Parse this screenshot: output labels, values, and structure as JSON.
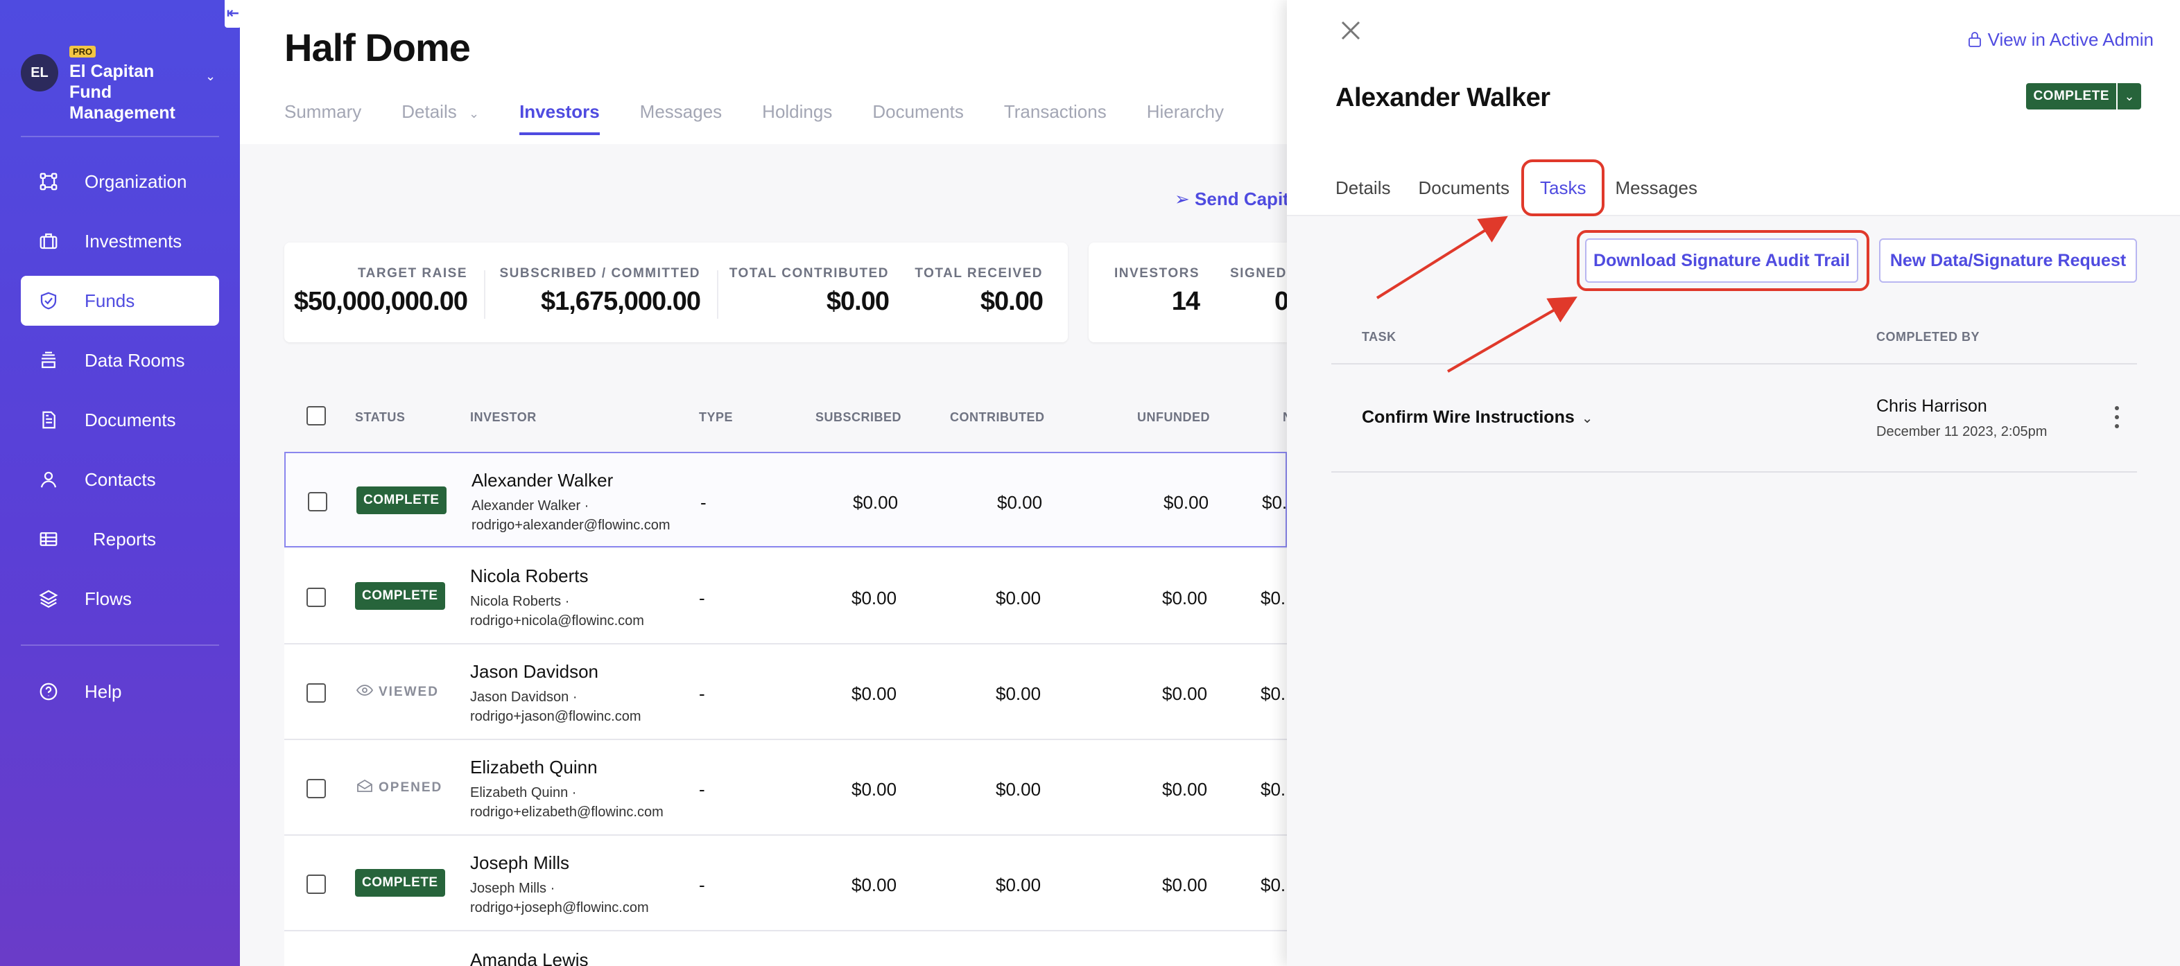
{
  "sidebar": {
    "org_initials": "EL",
    "org_badge": "PRO",
    "org_name": "El Capitan Fund Management",
    "items": [
      {
        "label": "Organization",
        "icon": "organization-icon"
      },
      {
        "label": "Investments",
        "icon": "briefcase-icon"
      },
      {
        "label": "Funds",
        "icon": "shield-check-icon",
        "active": true
      },
      {
        "label": "Data Rooms",
        "icon": "database-icon"
      },
      {
        "label": "Documents",
        "icon": "document-icon"
      },
      {
        "label": "Contacts",
        "icon": "person-icon"
      },
      {
        "label": "Reports",
        "icon": "table-icon"
      },
      {
        "label": "Flows",
        "icon": "layers-icon"
      }
    ],
    "help_label": "Help",
    "collapse_glyph": "⇤"
  },
  "main": {
    "title": "Half Dome",
    "tabs": [
      "Summary",
      "Details",
      "Investors",
      "Messages",
      "Holdings",
      "Documents",
      "Transactions",
      "Hierarchy"
    ],
    "active_tab": "Investors",
    "send_link": "Send Capit",
    "stats_card1": [
      {
        "label": "TARGET RAISE",
        "value": "$50,000,000.00"
      },
      {
        "label": "SUBSCRIBED / COMMITTED",
        "value": "$1,675,000.00"
      },
      {
        "label": "TOTAL CONTRIBUTED",
        "value": "$0.00"
      },
      {
        "label": "TOTAL RECEIVED",
        "value": "$0.00"
      }
    ],
    "stats_card2": [
      {
        "label": "INVESTORS",
        "value": "14"
      },
      {
        "label": "SIGNED",
        "value": "0"
      }
    ],
    "table": {
      "headers": [
        "STATUS",
        "INVESTOR",
        "TYPE",
        "SUBSCRIBED",
        "CONTRIBUTED",
        "UNFUNDED",
        "N"
      ],
      "rows": [
        {
          "status": "COMPLETE",
          "name": "Alexander Walker",
          "sub1": "Alexander Walker ·",
          "email": "rodrigo+alexander@flowinc.com",
          "type": "-",
          "subscribed": "$0.00",
          "contributed": "$0.00",
          "unfunded": "$0.00",
          "next": "$0."
        },
        {
          "status": "COMPLETE",
          "name": "Nicola Roberts",
          "sub1": "Nicola Roberts ·",
          "email": "rodrigo+nicola@flowinc.com",
          "type": "-",
          "subscribed": "$0.00",
          "contributed": "$0.00",
          "unfunded": "$0.00",
          "next": "$0."
        },
        {
          "status": "VIEWED",
          "name": "Jason Davidson",
          "sub1": "Jason Davidson ·",
          "email": "rodrigo+jason@flowinc.com",
          "type": "-",
          "subscribed": "$0.00",
          "contributed": "$0.00",
          "unfunded": "$0.00",
          "next": "$0."
        },
        {
          "status": "OPENED",
          "name": "Elizabeth Quinn",
          "sub1": "Elizabeth Quinn ·",
          "email": "rodrigo+elizabeth@flowinc.com",
          "type": "-",
          "subscribed": "$0.00",
          "contributed": "$0.00",
          "unfunded": "$0.00",
          "next": "$0."
        },
        {
          "status": "COMPLETE",
          "name": "Joseph Mills",
          "sub1": "Joseph Mills ·",
          "email": "rodrigo+joseph@flowinc.com",
          "type": "-",
          "subscribed": "$0.00",
          "contributed": "$0.00",
          "unfunded": "$0.00",
          "next": "$0."
        },
        {
          "status": "",
          "name": "Amanda Lewis",
          "sub1": "",
          "email": "",
          "type": "",
          "subscribed": "",
          "contributed": "",
          "unfunded": "",
          "next": ""
        }
      ]
    }
  },
  "drawer": {
    "admin_link": "View in Active Admin",
    "title": "Alexander Walker",
    "status": "COMPLETE",
    "tabs": [
      "Details",
      "Documents",
      "Tasks",
      "Messages"
    ],
    "active_tab": "Tasks",
    "buttons": {
      "audit": "Download Signature Audit Trail",
      "request": "New Data/Signature Request"
    },
    "task_headers": {
      "task": "TASK",
      "completed_by": "COMPLETED BY"
    },
    "tasks": [
      {
        "name": "Confirm Wire Instructions",
        "completed_by": "Chris Harrison",
        "completed_at": "December 11 2023, 2:05pm"
      }
    ]
  },
  "colors": {
    "accent": "#4f4be0",
    "status_complete": "#27643b",
    "annotation_red": "#e0392b"
  }
}
